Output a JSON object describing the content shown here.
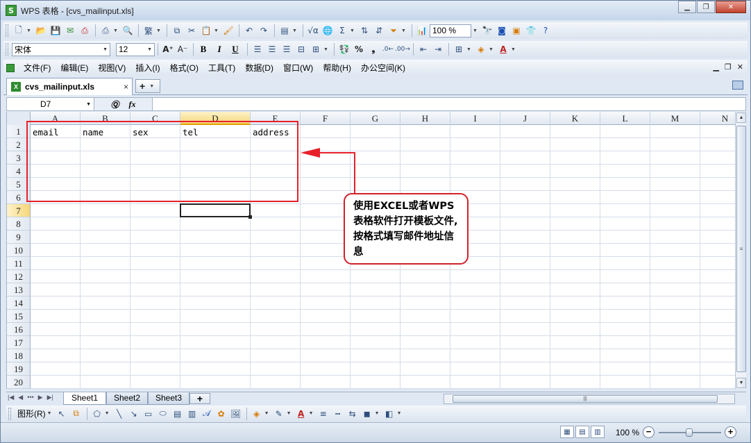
{
  "window": {
    "app_icon": "S",
    "title": "WPS 表格 - [cvs_mailinput.xls]",
    "controls": [
      "minimize-icon",
      "restore-icon",
      "close-icon"
    ]
  },
  "format_toolbar": {
    "font_name": "宋体",
    "font_size": "12",
    "bold": "B",
    "italic": "I",
    "underline": "U",
    "percent": "%",
    "comma": "❟",
    "font_color_letter": "A"
  },
  "standard_toolbar": {
    "zoom": "100 %",
    "sum": "Σ"
  },
  "menu": {
    "items": [
      "文件(F)",
      "编辑(E)",
      "视图(V)",
      "插入(I)",
      "格式(O)",
      "工具(T)",
      "数据(D)",
      "窗口(W)",
      "帮助(H)",
      "办公空间(K)"
    ]
  },
  "doc_tabs": {
    "active": "cvs_mailinput.xls",
    "close": "×",
    "new": "+"
  },
  "formula_bar": {
    "name_box": "D7",
    "fx": "fx",
    "value": ""
  },
  "grid": {
    "columns": [
      "A",
      "B",
      "C",
      "D",
      "E",
      "F",
      "G",
      "H",
      "I",
      "J",
      "K",
      "L",
      "M",
      "N"
    ],
    "rows": [
      "1",
      "2",
      "3",
      "4",
      "5",
      "6",
      "7",
      "8",
      "9",
      "10",
      "11",
      "12",
      "13",
      "14",
      "15",
      "16",
      "17",
      "18",
      "19",
      "20"
    ],
    "active_cell": "D7",
    "cells": {
      "A1": "email",
      "B1": "name",
      "C1": "sex",
      "D1": "tel",
      "E1": "address"
    }
  },
  "annotation": {
    "callout_text": "使用EXCEL或者WPS表格软件打开模板文件,按格式填写邮件地址信息",
    "color": "#e8202a"
  },
  "sheets": {
    "tabs": [
      "Sheet1",
      "Sheet2",
      "Sheet3"
    ],
    "active": "Sheet1"
  },
  "draw_toolbar": {
    "label": "图形(R)",
    "font_color_letter": "A"
  },
  "status": {
    "zoom": "100 %"
  }
}
